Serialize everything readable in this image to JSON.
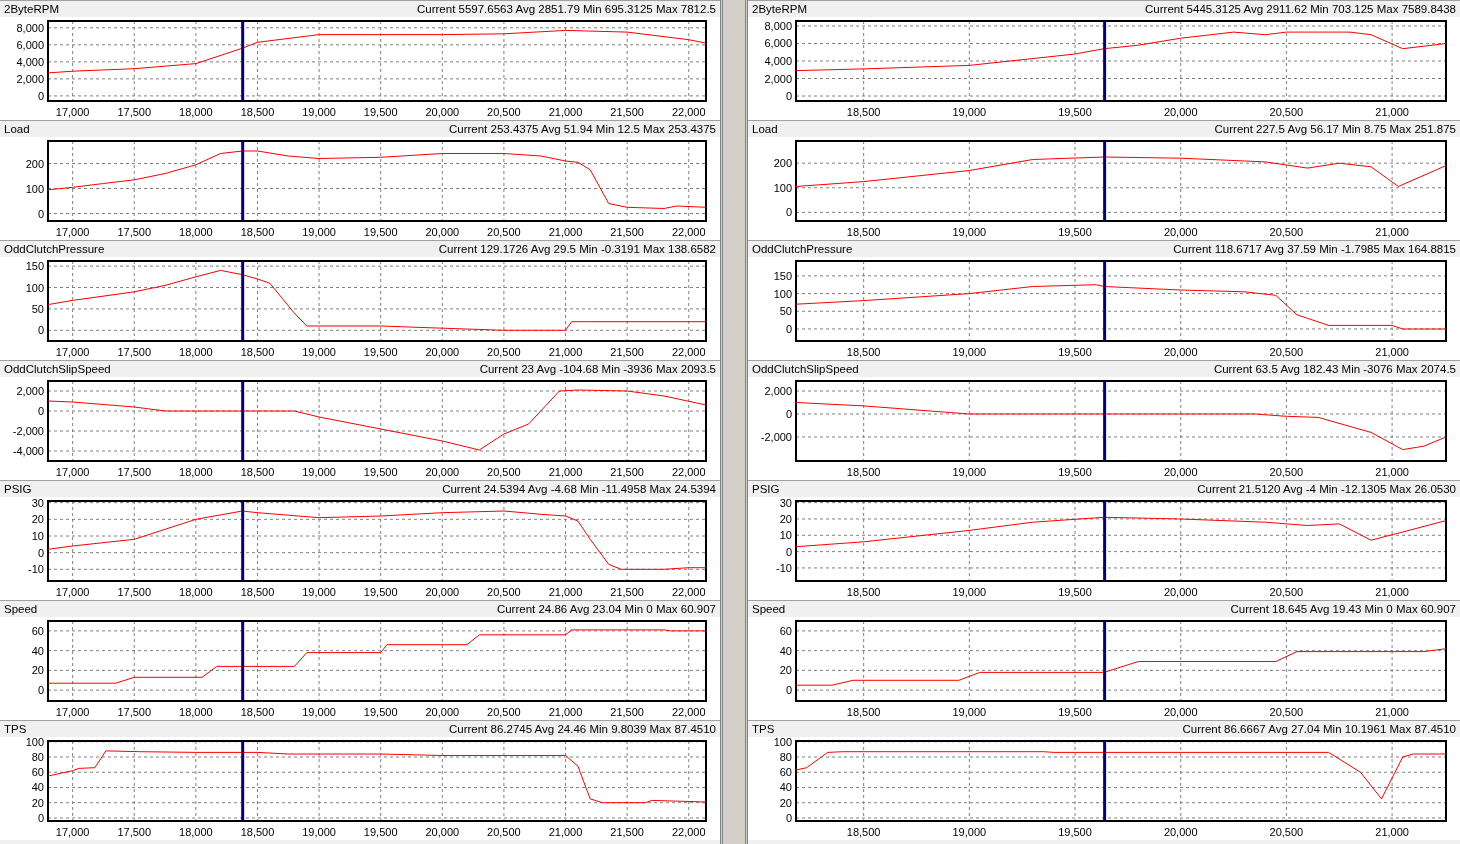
{
  "panels": [
    {
      "graphs": [
        {
          "stats": "Current 5597.6563 Avg 2851.79 Min 695.3125 Max 7812.5",
          "chart_data": {
            "type": "line",
            "title": "2ByteRPM",
            "grid": true,
            "x": [
              16800,
              17000,
              17500,
              18000,
              18378,
              18500,
              19000,
              19500,
              20000,
              20500,
              21000,
              21500,
              22000,
              22140
            ],
            "series": [
              {
                "color": "#ff0000",
                "values": [
                  2700,
                  2900,
                  3200,
                  3800,
                  5600,
                  6300,
                  7200,
                  7200,
                  7200,
                  7300,
                  7700,
                  7500,
                  6600,
                  6200
                ]
              }
            ],
            "xlim": [
              16800,
              22140
            ],
            "ylim": [
              -600,
              8800
            ],
            "xticks": [
              {
                "value": 17000,
                "label": "17,000"
              },
              {
                "value": 17500,
                "label": "17,500"
              },
              {
                "value": 18000,
                "label": "18,000"
              },
              {
                "value": 18500,
                "label": "18,500"
              },
              {
                "value": 19000,
                "label": "19,000"
              },
              {
                "value": 19500,
                "label": "19,500"
              },
              {
                "value": 20000,
                "label": "20,000"
              },
              {
                "value": 20500,
                "label": "20,500"
              },
              {
                "value": 21000,
                "label": "21,000"
              },
              {
                "value": 21500,
                "label": "21,500"
              },
              {
                "value": 22000,
                "label": "22,000"
              }
            ],
            "yticks": [
              0,
              {
                "value": 2000,
                "label": "2,000"
              },
              {
                "value": 4000,
                "label": "4,000"
              },
              {
                "value": 6000,
                "label": "6,000"
              },
              {
                "value": 8000,
                "label": "8,000"
              }
            ],
            "ref_lines": [
              {
                "axis": "x",
                "value": 18380,
                "color": "#000080"
              }
            ]
          }
        },
        {
          "stats": "Current 253.4375 Avg 51.94 Min 12.5 Max 253.4375",
          "chart_data": {
            "type": "line",
            "title": "Load",
            "grid": true,
            "x": [
              16800,
              17000,
              17250,
              17500,
              17750,
              18000,
              18200,
              18378,
              18500,
              18750,
              19000,
              19500,
              20000,
              20500,
              20800,
              21000,
              21100,
              21200,
              21350,
              21500,
              21800,
              21900,
              22140
            ],
            "series": [
              {
                "color": "#ff0000",
                "values": [
                  95,
                  105,
                  120,
                  135,
                  160,
                  195,
                  240,
                  250,
                  250,
                  230,
                  220,
                  225,
                  240,
                  240,
                  230,
                  210,
                  205,
                  175,
                  40,
                  25,
                  20,
                  30,
                  25
                ]
              }
            ],
            "xlim": [
              16800,
              22140
            ],
            "ylim": [
              -30,
              290
            ],
            "xticks": [
              {
                "value": 17000,
                "label": "17,000"
              },
              {
                "value": 17500,
                "label": "17,500"
              },
              {
                "value": 18000,
                "label": "18,000"
              },
              {
                "value": 18500,
                "label": "18,500"
              },
              {
                "value": 19000,
                "label": "19,000"
              },
              {
                "value": 19500,
                "label": "19,500"
              },
              {
                "value": 20000,
                "label": "20,000"
              },
              {
                "value": 20500,
                "label": "20,500"
              },
              {
                "value": 21000,
                "label": "21,000"
              },
              {
                "value": 21500,
                "label": "21,500"
              },
              {
                "value": 22000,
                "label": "22,000"
              }
            ],
            "yticks": [
              0,
              100,
              200
            ],
            "ref_lines": [
              {
                "axis": "x",
                "value": 18380,
                "color": "#000080"
              }
            ]
          }
        },
        {
          "stats": "Current 129.1726 Avg 29.5 Min -0.3191 Max 138.6582",
          "chart_data": {
            "type": "line",
            "title": "OddClutchPressure",
            "grid": true,
            "x": [
              16800,
              17000,
              17500,
              17750,
              18000,
              18200,
              18378,
              18500,
              18600,
              18700,
              18800,
              18900,
              19000,
              19500,
              20000,
              20500,
              21000,
              21050,
              21200,
              21500,
              22140
            ],
            "series": [
              {
                "color": "#ff0000",
                "values": [
                  60,
                  70,
                  90,
                  105,
                  125,
                  140,
                  130,
                  120,
                  110,
                  75,
                  40,
                  10,
                  10,
                  10,
                  5,
                  0,
                  0,
                  20,
                  20,
                  20,
                  20
                ]
              }
            ],
            "xlim": [
              16800,
              22140
            ],
            "ylim": [
              -25,
              162
            ],
            "xticks": [
              {
                "value": 17000,
                "label": "17,000"
              },
              {
                "value": 17500,
                "label": "17,500"
              },
              {
                "value": 18000,
                "label": "18,000"
              },
              {
                "value": 18500,
                "label": "18,500"
              },
              {
                "value": 19000,
                "label": "19,000"
              },
              {
                "value": 19500,
                "label": "19,500"
              },
              {
                "value": 20000,
                "label": "20,000"
              },
              {
                "value": 20500,
                "label": "20,500"
              },
              {
                "value": 21000,
                "label": "21,000"
              },
              {
                "value": 21500,
                "label": "21,500"
              },
              {
                "value": 22000,
                "label": "22,000"
              }
            ],
            "yticks": [
              0,
              50,
              100,
              150
            ],
            "ref_lines": [
              {
                "axis": "x",
                "value": 18380,
                "color": "#000080"
              }
            ]
          }
        },
        {
          "stats": "Current 23 Avg -104.68 Min -3936 Max 2093.5",
          "chart_data": {
            "type": "line",
            "title": "OddClutchSlipSpeed",
            "grid": true,
            "x": [
              16800,
              17000,
              17500,
              17750,
              18378,
              18800,
              19000,
              19500,
              20000,
              20300,
              20500,
              20700,
              20950,
              21100,
              21500,
              21800,
              22140
            ],
            "series": [
              {
                "color": "#ff0000",
                "values": [
                  1000,
                  900,
                  400,
                  0,
                  0,
                  0,
                  -600,
                  -1800,
                  -3000,
                  -3900,
                  -2300,
                  -1300,
                  2000,
                  2100,
                  2000,
                  1500,
                  600
                ]
              }
            ],
            "xlim": [
              16800,
              22140
            ],
            "ylim": [
              -5000,
              3000
            ],
            "xticks": [
              {
                "value": 17000,
                "label": "17,000"
              },
              {
                "value": 17500,
                "label": "17,500"
              },
              {
                "value": 18000,
                "label": "18,000"
              },
              {
                "value": 18500,
                "label": "18,500"
              },
              {
                "value": 19000,
                "label": "19,000"
              },
              {
                "value": 19500,
                "label": "19,500"
              },
              {
                "value": 20000,
                "label": "20,000"
              },
              {
                "value": 20500,
                "label": "20,500"
              },
              {
                "value": 21000,
                "label": "21,000"
              },
              {
                "value": 21500,
                "label": "21,500"
              },
              {
                "value": 22000,
                "label": "22,000"
              }
            ],
            "yticks": [
              {
                "value": -4000,
                "label": "-4,000"
              },
              {
                "value": -2000,
                "label": "-2,000"
              },
              0,
              {
                "value": 2000,
                "label": "2,000"
              }
            ],
            "ref_lines": [
              {
                "axis": "x",
                "value": 18380,
                "color": "#000080"
              }
            ]
          }
        },
        {
          "stats": "Current 24.5394 Avg -4.68 Min -11.4958 Max 24.5394",
          "chart_data": {
            "type": "line",
            "title": "PSIG",
            "grid": true,
            "x": [
              16800,
              17000,
              17500,
              17750,
              18000,
              18378,
              18500,
              19000,
              19500,
              20000,
              20500,
              20800,
              21000,
              21100,
              21200,
              21350,
              21450,
              21800,
              22000,
              22140
            ],
            "series": [
              {
                "color": "#ff0000",
                "values": [
                  2,
                  4,
                  8,
                  14,
                  20,
                  25,
                  24,
                  21,
                  22,
                  24,
                  25,
                  23,
                  22,
                  19,
                  8,
                  -7,
                  -10,
                  -10,
                  -9,
                  -9
                ]
              }
            ],
            "xlim": [
              16800,
              22140
            ],
            "ylim": [
              -17,
              31
            ],
            "xticks": [
              {
                "value": 17000,
                "label": "17,000"
              },
              {
                "value": 17500,
                "label": "17,500"
              },
              {
                "value": 18000,
                "label": "18,000"
              },
              {
                "value": 18500,
                "label": "18,500"
              },
              {
                "value": 19000,
                "label": "19,000"
              },
              {
                "value": 19500,
                "label": "19,500"
              },
              {
                "value": 20000,
                "label": "20,000"
              },
              {
                "value": 20500,
                "label": "20,500"
              },
              {
                "value": 21000,
                "label": "21,000"
              },
              {
                "value": 21500,
                "label": "21,500"
              },
              {
                "value": 22000,
                "label": "22,000"
              }
            ],
            "yticks": [
              -10,
              0,
              10,
              20,
              30
            ],
            "ref_lines": [
              {
                "axis": "x",
                "value": 18380,
                "color": "#000080"
              }
            ]
          }
        },
        {
          "stats": "Current 24.86 Avg 23.04 Min 0 Max 60.907",
          "chart_data": {
            "type": "line",
            "title": "Speed",
            "grid": true,
            "x": [
              16800,
              17350,
              17500,
              18050,
              18170,
              18800,
              18900,
              19500,
              19550,
              20200,
              20300,
              21000,
              21050,
              21800,
              21850,
              22140
            ],
            "series": [
              {
                "color": "#ff0000",
                "values": [
                  7,
                  7,
                  13,
                  13,
                  24,
                  24,
                  38,
                  38,
                  46,
                  46,
                  56,
                  56,
                  61,
                  61,
                  60,
                  60
                ]
              }
            ],
            "xlim": [
              16800,
              22140
            ],
            "ylim": [
              -11,
              70
            ],
            "xticks": [
              {
                "value": 17000,
                "label": "17,000"
              },
              {
                "value": 17500,
                "label": "17,500"
              },
              {
                "value": 18000,
                "label": "18,000"
              },
              {
                "value": 18500,
                "label": "18,500"
              },
              {
                "value": 19000,
                "label": "19,000"
              },
              {
                "value": 19500,
                "label": "19,500"
              },
              {
                "value": 20000,
                "label": "20,000"
              },
              {
                "value": 20500,
                "label": "20,500"
              },
              {
                "value": 21000,
                "label": "21,000"
              },
              {
                "value": 21500,
                "label": "21,500"
              },
              {
                "value": 22000,
                "label": "22,000"
              }
            ],
            "yticks": [
              0,
              20,
              40,
              60
            ],
            "ref_lines": [
              {
                "axis": "x",
                "value": 18380,
                "color": "#000080"
              }
            ]
          }
        },
        {
          "stats": "Current 86.2745 Avg 24.46 Min 9.8039 Max 87.4510",
          "chart_data": {
            "type": "line",
            "title": "TPS",
            "grid": true,
            "x": [
              16800,
              17000,
              17050,
              17180,
              17270,
              17550,
              18000,
              18500,
              18750,
              19500,
              20000,
              21000,
              21100,
              21200,
              21300,
              21650,
              21700,
              22140
            ],
            "series": [
              {
                "color": "#ff0000",
                "values": [
                  55,
                  62,
                  65,
                  66,
                  88,
                  87,
                  86,
                  86,
                  84,
                  84,
                  82,
                  82,
                  68,
                  25,
                  20,
                  20,
                  23,
                  21
                ]
              }
            ],
            "xlim": [
              16800,
              22140
            ],
            "ylim": [
              -4,
              101
            ],
            "xticks": [
              {
                "value": 17000,
                "label": "17,000"
              },
              {
                "value": 17500,
                "label": "17,500"
              },
              {
                "value": 18000,
                "label": "18,000"
              },
              {
                "value": 18500,
                "label": "18,500"
              },
              {
                "value": 19000,
                "label": "19,000"
              },
              {
                "value": 19500,
                "label": "19,500"
              },
              {
                "value": 20000,
                "label": "20,000"
              },
              {
                "value": 20500,
                "label": "20,500"
              },
              {
                "value": 21000,
                "label": "21,000"
              },
              {
                "value": 21500,
                "label": "21,500"
              },
              {
                "value": 22000,
                "label": "22,000"
              }
            ],
            "yticks": [
              0,
              20,
              40,
              60,
              80,
              100
            ],
            "ref_lines": [
              {
                "axis": "x",
                "value": 18380,
                "color": "#000080"
              }
            ]
          }
        }
      ]
    },
    {
      "graphs": [
        {
          "stats": "Current 5445.3125 Avg 2911.62 Min 703.125 Max 7589.8438",
          "chart_data": {
            "type": "line",
            "title": "2ByteRPM",
            "grid": true,
            "x": [
              18180,
              18500,
              19000,
              19500,
              19637,
              19800,
              20000,
              20250,
              20400,
              20500,
              20800,
              20900,
              21050,
              21255
            ],
            "series": [
              {
                "color": "#ff0000",
                "values": [
                  2900,
                  3100,
                  3500,
                  4800,
                  5400,
                  5800,
                  6600,
                  7300,
                  7000,
                  7300,
                  7300,
                  7000,
                  5400,
                  6000
                ]
              }
            ],
            "xlim": [
              18180,
              21255
            ],
            "ylim": [
              -570,
              8570
            ],
            "xticks": [
              {
                "value": 18500,
                "label": "18,500"
              },
              {
                "value": 19000,
                "label": "19,000"
              },
              {
                "value": 19500,
                "label": "19,500"
              },
              {
                "value": 20000,
                "label": "20,000"
              },
              {
                "value": 20500,
                "label": "20,500"
              },
              {
                "value": 21000,
                "label": "21,000"
              }
            ],
            "yticks": [
              0,
              {
                "value": 2000,
                "label": "2,000"
              },
              {
                "value": 4000,
                "label": "4,000"
              },
              {
                "value": 6000,
                "label": "6,000"
              },
              {
                "value": 8000,
                "label": "8,000"
              }
            ],
            "ref_lines": [
              {
                "axis": "x",
                "value": 19640,
                "color": "#000080"
              }
            ]
          }
        },
        {
          "stats": "Current 227.5 Avg 56.17 Min 8.75 Max 251.875",
          "chart_data": {
            "type": "line",
            "title": "Load",
            "grid": true,
            "x": [
              18180,
              18500,
              19000,
              19300,
              19637,
              20000,
              20400,
              20600,
              20750,
              20900,
              21030,
              21255
            ],
            "series": [
              {
                "color": "#ff0000",
                "values": [
                  105,
                  125,
                  170,
                  215,
                  225,
                  220,
                  205,
                  180,
                  200,
                  185,
                  105,
                  190
                ]
              }
            ],
            "xlim": [
              18180,
              21255
            ],
            "ylim": [
              -35,
              290
            ],
            "xticks": [
              {
                "value": 18500,
                "label": "18,500"
              },
              {
                "value": 19000,
                "label": "19,000"
              },
              {
                "value": 19500,
                "label": "19,500"
              },
              {
                "value": 20000,
                "label": "20,000"
              },
              {
                "value": 20500,
                "label": "20,500"
              },
              {
                "value": 21000,
                "label": "21,000"
              }
            ],
            "yticks": [
              0,
              100,
              200
            ],
            "ref_lines": [
              {
                "axis": "x",
                "value": 19640,
                "color": "#000080"
              }
            ]
          }
        },
        {
          "stats": "Current 118.6717 Avg 37.59 Min -1.7985 Max 164.8815",
          "chart_data": {
            "type": "line",
            "title": "OddClutchPressure",
            "grid": true,
            "x": [
              18180,
              18500,
              19000,
              19300,
              19600,
              19637,
              20000,
              20300,
              20450,
              20550,
              20700,
              21000,
              21050,
              21255
            ],
            "series": [
              {
                "color": "#ff0000",
                "values": [
                  70,
                  80,
                  100,
                  120,
                  125,
                  120,
                  110,
                  105,
                  95,
                  40,
                  10,
                  10,
                  0,
                  0
                ]
              }
            ],
            "xlim": [
              18180,
              21255
            ],
            "ylim": [
              -34,
              192
            ],
            "xticks": [
              {
                "value": 18500,
                "label": "18,500"
              },
              {
                "value": 19000,
                "label": "19,000"
              },
              {
                "value": 19500,
                "label": "19,500"
              },
              {
                "value": 20000,
                "label": "20,000"
              },
              {
                "value": 20500,
                "label": "20,500"
              },
              {
                "value": 21000,
                "label": "21,000"
              }
            ],
            "yticks": [
              0,
              50,
              100,
              150
            ],
            "ref_lines": [
              {
                "axis": "x",
                "value": 19640,
                "color": "#000080"
              }
            ]
          }
        },
        {
          "stats": "Current 63.5 Avg 182.43 Min -3076 Max 2074.5",
          "chart_data": {
            "type": "line",
            "title": "OddClutchSlipSpeed",
            "grid": true,
            "x": [
              18180,
              18500,
              19000,
              19637,
              20000,
              20350,
              20500,
              20650,
              20900,
              21050,
              21150,
              21255
            ],
            "series": [
              {
                "color": "#ff0000",
                "values": [
                  1000,
                  700,
                  0,
                  0,
                  0,
                  0,
                  -200,
                  -300,
                  -1600,
                  -3100,
                  -2800,
                  -2000
                ]
              }
            ],
            "xlim": [
              18180,
              21255
            ],
            "ylim": [
              -4090,
              2870
            ],
            "xticks": [
              {
                "value": 18500,
                "label": "18,500"
              },
              {
                "value": 19000,
                "label": "19,000"
              },
              {
                "value": 19500,
                "label": "19,500"
              },
              {
                "value": 20000,
                "label": "20,000"
              },
              {
                "value": 20500,
                "label": "20,500"
              },
              {
                "value": 21000,
                "label": "21,000"
              }
            ],
            "yticks": [
              {
                "value": -2000,
                "label": "-2,000"
              },
              0,
              {
                "value": 2000,
                "label": "2,000"
              }
            ],
            "ref_lines": [
              {
                "axis": "x",
                "value": 19640,
                "color": "#000080"
              }
            ]
          }
        },
        {
          "stats": "Current 21.5120 Avg -4 Min -12.1305 Max 26.0530",
          "chart_data": {
            "type": "line",
            "title": "PSIG",
            "grid": true,
            "x": [
              18180,
              18500,
              19000,
              19300,
              19637,
              20000,
              20400,
              20600,
              20750,
              20900,
              21050,
              21255
            ],
            "series": [
              {
                "color": "#ff0000",
                "values": [
                  3,
                  6,
                  13,
                  18,
                  21,
                  20,
                  18,
                  16,
                  17,
                  7,
                  12,
                  19
                ]
              }
            ],
            "xlim": [
              18180,
              21255
            ],
            "ylim": [
              -18,
              31
            ],
            "xticks": [
              {
                "value": 18500,
                "label": "18,500"
              },
              {
                "value": 19000,
                "label": "19,000"
              },
              {
                "value": 19500,
                "label": "19,500"
              },
              {
                "value": 20000,
                "label": "20,000"
              },
              {
                "value": 20500,
                "label": "20,500"
              },
              {
                "value": 21000,
                "label": "21,000"
              }
            ],
            "yticks": [
              -10,
              0,
              10,
              20,
              30
            ],
            "ref_lines": [
              {
                "axis": "x",
                "value": 19640,
                "color": "#000080"
              }
            ]
          }
        },
        {
          "stats": "Current 18.645 Avg 19.43 Min 0 Max 60.907",
          "chart_data": {
            "type": "line",
            "title": "Speed",
            "grid": true,
            "x": [
              18180,
              18350,
              18450,
              18950,
              19050,
              19637,
              19800,
              20450,
              20550,
              21150,
              21255
            ],
            "series": [
              {
                "color": "#ff0000",
                "values": [
                  5,
                  5,
                  10,
                  10,
                  18,
                  18,
                  29,
                  29,
                  39,
                  39,
                  42
                ]
              }
            ],
            "xlim": [
              18180,
              21255
            ],
            "ylim": [
              -11,
              70
            ],
            "xticks": [
              {
                "value": 18500,
                "label": "18,500"
              },
              {
                "value": 19000,
                "label": "19,000"
              },
              {
                "value": 19500,
                "label": "19,500"
              },
              {
                "value": 20000,
                "label": "20,000"
              },
              {
                "value": 20500,
                "label": "20,500"
              },
              {
                "value": 21000,
                "label": "21,000"
              }
            ],
            "yticks": [
              0,
              20,
              40,
              60
            ],
            "ref_lines": [
              {
                "axis": "x",
                "value": 19640,
                "color": "#000080"
              }
            ]
          }
        },
        {
          "stats": "Current 86.6667 Avg 27.04 Min 10.1961 Max 87.4510",
          "chart_data": {
            "type": "line",
            "title": "TPS",
            "grid": true,
            "x": [
              18180,
              18230,
              18330,
              18400,
              19350,
              19400,
              20700,
              20850,
              20950,
              21050,
              21100,
              21255
            ],
            "series": [
              {
                "color": "#ff0000",
                "values": [
                  63,
                  66,
                  86,
                  87,
                  87,
                  86,
                  86,
                  60,
                  25,
                  80,
                  84,
                  84
                ]
              }
            ],
            "xlim": [
              18180,
              21255
            ],
            "ylim": [
              -4,
              101
            ],
            "xticks": [
              {
                "value": 18500,
                "label": "18,500"
              },
              {
                "value": 19000,
                "label": "19,000"
              },
              {
                "value": 19500,
                "label": "19,500"
              },
              {
                "value": 20000,
                "label": "20,000"
              },
              {
                "value": 20500,
                "label": "20,500"
              },
              {
                "value": 21000,
                "label": "21,000"
              }
            ],
            "yticks": [
              0,
              20,
              40,
              60,
              80,
              100
            ],
            "ref_lines": [
              {
                "axis": "x",
                "value": 19640,
                "color": "#000080"
              }
            ]
          }
        }
      ]
    }
  ]
}
